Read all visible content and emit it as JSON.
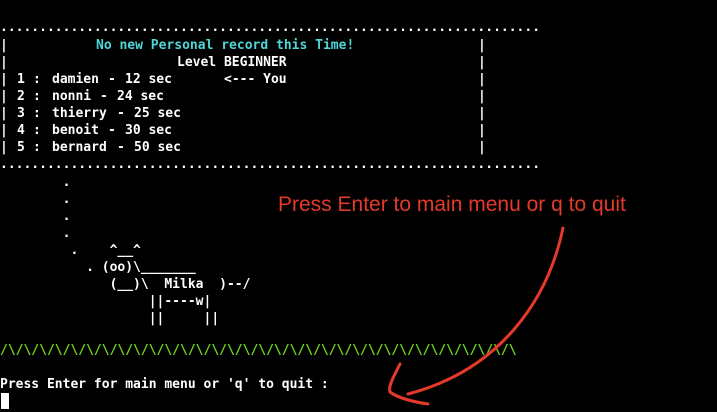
{
  "terminal": {
    "border_dots": ".....................................................................",
    "box_side": "|",
    "header_title": "No new Personal record this Time!",
    "header_level": "Level BEGINNER",
    "scores": [
      {
        "rank": "1",
        "name": "damien",
        "time": "12 sec",
        "marker": "<--- You"
      },
      {
        "rank": "2",
        "name": "nonni",
        "time": "24 sec",
        "marker": ""
      },
      {
        "rank": "3",
        "name": "thierry",
        "time": "25 sec",
        "marker": ""
      },
      {
        "rank": "4",
        "name": "benoit",
        "time": "30 sec",
        "marker": ""
      },
      {
        "rank": "5",
        "name": "bernard",
        "time": "50 sec",
        "marker": ""
      }
    ],
    "cow_art": [
      "        .",
      "        .",
      "        .",
      "        .",
      "         .    ^__^",
      "           . (oo)\\_______",
      "              (__)\\  Milka  )--/",
      "                   ||----w|",
      "                   ||     ||"
    ],
    "grass": "/\\/\\/\\/\\/\\/\\/\\/\\/\\/\\/\\/\\/\\/\\/\\/\\/\\/\\/\\/\\/\\/\\/\\/\\/\\/\\/\\/\\/\\/\\/\\/\\/\\",
    "prompt": "Press Enter for main menu or 'q' to quit :"
  },
  "annotation": {
    "text": "Press Enter to main menu or q to quit",
    "color": "#e5392b"
  },
  "colors": {
    "background": "#000000",
    "text": "#ffffff",
    "header": "#4fd6d6",
    "grass": "#6cd620"
  }
}
